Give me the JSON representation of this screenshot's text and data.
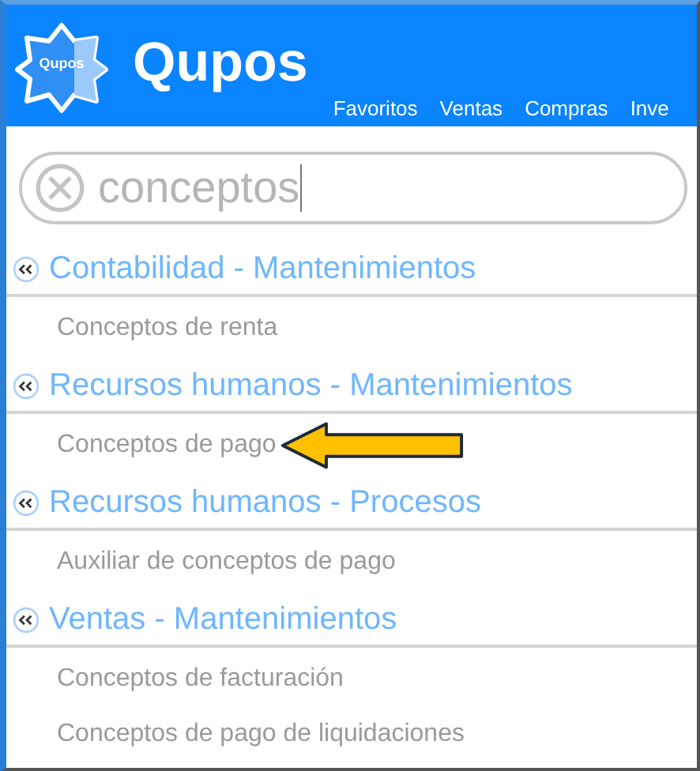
{
  "header": {
    "logo_text": "Qupos",
    "brand": "Qupos",
    "menu": [
      "Favoritos",
      "Ventas",
      "Compras",
      "Inve"
    ]
  },
  "search": {
    "value": "conceptos"
  },
  "groups": [
    {
      "title": "Contabilidad - Mantenimientos",
      "items": [
        {
          "label": "Conceptos de renta",
          "arrow": false
        }
      ]
    },
    {
      "title": "Recursos humanos - Mantenimientos",
      "items": [
        {
          "label": "Conceptos de pago",
          "arrow": true
        }
      ]
    },
    {
      "title": "Recursos humanos - Procesos",
      "items": [
        {
          "label": "Auxiliar de conceptos de pago",
          "arrow": false
        }
      ]
    },
    {
      "title": "Ventas - Mantenimientos",
      "items": [
        {
          "label": "Conceptos de facturación",
          "arrow": false
        },
        {
          "label": "Conceptos de pago de liquidaciones",
          "arrow": false
        }
      ]
    }
  ]
}
